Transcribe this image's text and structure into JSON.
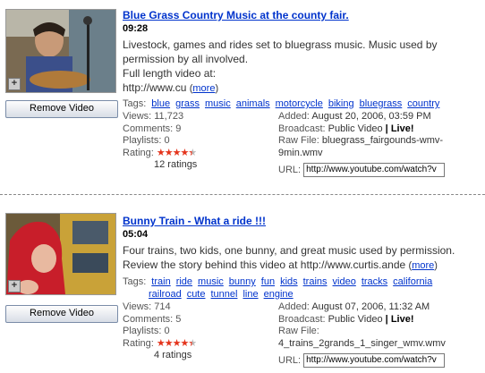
{
  "colors": {
    "link": "#0033cc",
    "star": "#e4341c"
  },
  "videos": [
    {
      "title": "Blue Grass Country Music at the county fair.",
      "duration": "09:28",
      "description": "Livestock, games and rides set to bluegrass music. Music used by permission by all involved.",
      "description2": "Full length video at:",
      "description3": "http://www.cu",
      "more_label": "more",
      "remove_label": "Remove Video",
      "tags_label": "Tags:",
      "tags": [
        "blue",
        "grass",
        "music",
        "animals",
        "motorcycle",
        "biking",
        "bluegrass",
        "country"
      ],
      "views": "Views: 11,723",
      "comments": "Comments: 9",
      "playlists": "Playlists: 0",
      "rating_label": "Rating:",
      "rating_stars": 4.5,
      "rating_glyphs": "★★★★★",
      "ratings_count": "12 ratings",
      "added_label": "Added:",
      "added": "August 20, 2006, 03:59 PM",
      "broadcast_label": "Broadcast:",
      "broadcast": "Public Video",
      "live": "Live!",
      "rawfile_label": "Raw File:",
      "rawfile": "bluegrass_fairgounds-wmv-9min.wmv",
      "url_label": "URL:",
      "url": "http://www.youtube.com/watch?v"
    },
    {
      "title": "Bunny Train - What a ride !!!",
      "duration": "05:04",
      "description": "Four trains, two kids, one bunny, and great music used by permission.",
      "description2": "Review the story behind this video at http://www.curtis.ande",
      "more_label": "more",
      "remove_label": "Remove Video",
      "tags_label": "Tags:",
      "tags": [
        "train",
        "ride",
        "music",
        "bunny",
        "fun",
        "kids",
        "trains",
        "video",
        "tracks",
        "california",
        "railroad",
        "cute",
        "tunnel",
        "line",
        "engine"
      ],
      "views": "Views: 714",
      "comments": "Comments: 5",
      "playlists": "Playlists: 0",
      "rating_label": "Rating:",
      "rating_stars": 4.5,
      "rating_glyphs": "★★★★★",
      "ratings_count": "4 ratings",
      "added_label": "Added:",
      "added": "August 07, 2006, 11:32 AM",
      "broadcast_label": "Broadcast:",
      "broadcast": "Public Video",
      "live": "Live!",
      "rawfile_label": "Raw File:",
      "rawfile": "4_trains_2grands_1_singer_wmv.wmv",
      "url_label": "URL:",
      "url": "http://www.youtube.com/watch?v"
    }
  ]
}
